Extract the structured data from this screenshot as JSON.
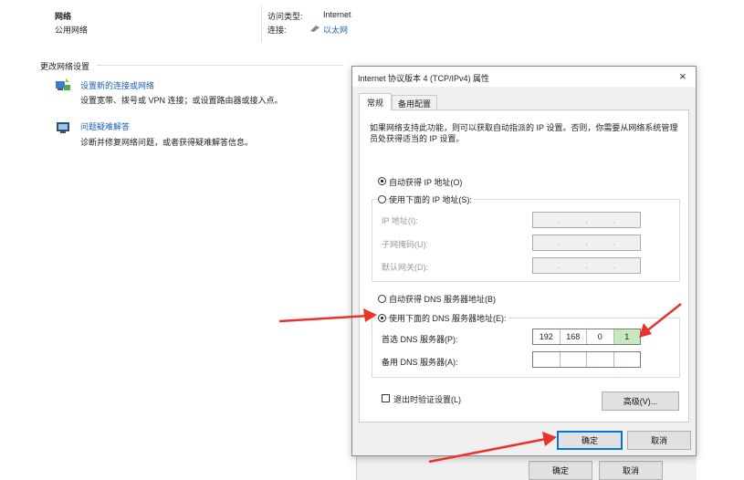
{
  "network": {
    "name": "网络",
    "type": "公用网络",
    "access_type_label": "访问类型:",
    "access_type_value": "Internet",
    "connection_label": "连接:",
    "connection_value": "以太网"
  },
  "change_settings": {
    "heading": "更改网络设置",
    "items": [
      {
        "title": "设置新的连接或网络",
        "desc": "设置宽带、拨号或 VPN 连接；或设置路由器或接入点。"
      },
      {
        "title": "问题疑难解答",
        "desc": "诊断并修复网络问题，或者获得疑难解答信息。"
      }
    ]
  },
  "dialog": {
    "title": "Internet 协议版本 4 (TCP/IPv4) 属性",
    "close": "×",
    "tabs": [
      "常规",
      "备用配置"
    ],
    "intro": "如果网络支持此功能，则可以获取自动指派的 IP 设置。否则，你需要从网络系统管理员处获得适当的 IP 设置。",
    "auto_ip": "自动获得 IP 地址(O)",
    "manual_ip": "使用下面的 IP 地址(S):",
    "ip_label": "IP 地址(I):",
    "mask_label": "子网掩码(U):",
    "gateway_label": "默认网关(D):",
    "auto_dns": "自动获得 DNS 服务器地址(B)",
    "manual_dns": "使用下面的 DNS 服务器地址(E):",
    "pref_dns_label": "首选 DNS 服务器(P):",
    "pref_dns": [
      "192",
      "168",
      "0",
      "1"
    ],
    "alt_dns_label": "备用 DNS 服务器(A):",
    "validate": "退出时验证设置(L)",
    "advanced": "高级(V)...",
    "ok": "确定",
    "cancel": "取消",
    "dot": "."
  },
  "bg_buttons": {
    "ok": "确定",
    "cancel": "取消"
  },
  "colors": {
    "arrow": "#e8342a",
    "link": "#1a5fb4",
    "accent": "#0078d7"
  }
}
